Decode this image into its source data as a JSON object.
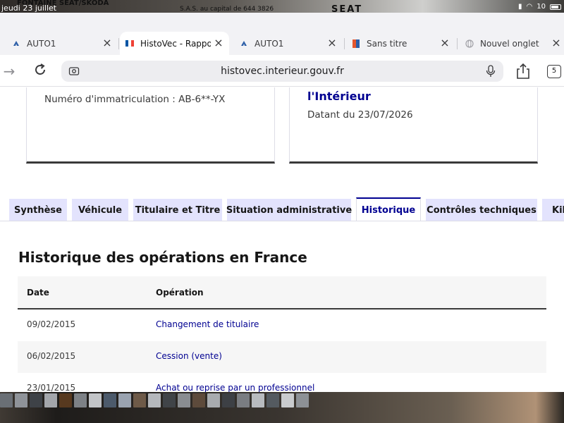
{
  "status_bar": {
    "day_label": "jeudi 23 juillet",
    "clock_partial": "10"
  },
  "backdrop": {
    "dealer_sign": "FONTAINE SEAT/SKODA",
    "company_line": "S.A.S. au capital de 644 3826",
    "brand_logo": "SEAT"
  },
  "browser": {
    "tabs": [
      {
        "label": "AUTO1",
        "favicon": "auto1-icon",
        "active": false
      },
      {
        "label": "HistoVec - Rapport",
        "favicon": "french-flag-icon",
        "active": true
      },
      {
        "label": "AUTO1",
        "favicon": "auto1-icon",
        "active": false
      },
      {
        "label": "Sans titre",
        "favicon": "document-color-icon",
        "active": false
      },
      {
        "label": "Nouvel onglet",
        "favicon": "globe-icon",
        "active": false
      }
    ],
    "url": "histovec.interieur.gouv.fr",
    "tab_count": "5"
  },
  "cards": {
    "left_text": "Numéro d'immatriculation : AB-6**-YX",
    "right_title": "l'Intérieur",
    "right_date": "Datant du 23/07/2026"
  },
  "page_tabs": [
    {
      "label": "Synthèse",
      "active": false
    },
    {
      "label": "Véhicule",
      "active": false
    },
    {
      "label": "Titulaire et Titre",
      "active": false
    },
    {
      "label": "Situation administrative",
      "active": false
    },
    {
      "label": "Historique",
      "active": true
    },
    {
      "label": "Contrôles techniques",
      "active": false
    },
    {
      "label": "Kil",
      "active": false
    }
  ],
  "history": {
    "title": "Historique des opérations en France",
    "columns": [
      "Date",
      "Opération"
    ],
    "rows": [
      {
        "date": "09/02/2015",
        "operation": "Changement de titulaire"
      },
      {
        "date": "06/02/2015",
        "operation": "Cession (vente)"
      },
      {
        "date": "23/01/2015",
        "operation": "Achat ou reprise par un professionnel"
      }
    ]
  },
  "colors": {
    "accent": "#000091",
    "tab_bg": "#e3e3fd",
    "row_alt": "#f6f6f6"
  }
}
